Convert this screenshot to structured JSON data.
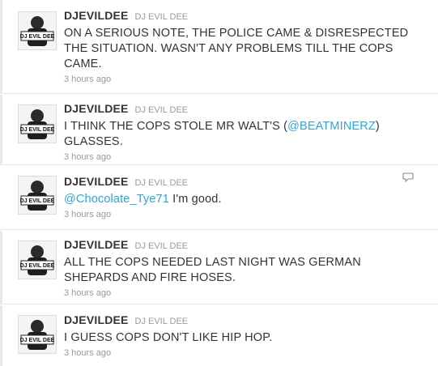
{
  "tweets": [
    {
      "screen_name": "DJEVILDEE",
      "full_name": "DJ EVIL DEE",
      "text_before": "ON A SERIOUS NOTE, THE POLICE CAME & DISRESPECTED THE SITUATION. WASN'T ANY PROBLEMS TILL THE COPS CAME.",
      "mention": "",
      "text_after": "",
      "time": "3 hours ago",
      "avatar_icon": "user-avatar-icon"
    },
    {
      "screen_name": "DJEVILDEE",
      "full_name": "DJ EVIL DEE",
      "text_before": "I THINK THE COPS STOLE MR WALT'S (",
      "mention": "@BEATMINERZ",
      "text_after": ") GLASSES.",
      "time": "3 hours ago",
      "avatar_icon": "user-avatar-icon"
    },
    {
      "screen_name": "DJEVILDEE",
      "full_name": "DJ EVIL DEE",
      "text_before": "",
      "mention": "@Chocolate_Tye71",
      "text_after": " I'm good.",
      "time": "3 hours ago",
      "avatar_icon": "user-avatar-icon",
      "has_reply_icon": true
    },
    {
      "screen_name": "DJEVILDEE",
      "full_name": "DJ EVIL DEE",
      "text_before": "ALL THE COPS NEEDED LAST NIGHT WAS GERMAN SHEPARDS AND FIRE HOSES.",
      "mention": "",
      "text_after": "",
      "time": "3 hours ago",
      "avatar_icon": "user-avatar-icon"
    },
    {
      "screen_name": "DJEVILDEE",
      "full_name": "DJ EVIL DEE",
      "text_before": "I GUESS COPS DON'T LIKE HIP HOP.",
      "mention": "",
      "text_after": "",
      "time": "3 hours ago",
      "avatar_icon": "user-avatar-icon"
    }
  ],
  "colors": {
    "mention": "#2aa5e0",
    "screen_name": "#333333",
    "meta": "#999999"
  },
  "icons": {
    "reply": "reply-speech-bubble-icon"
  }
}
